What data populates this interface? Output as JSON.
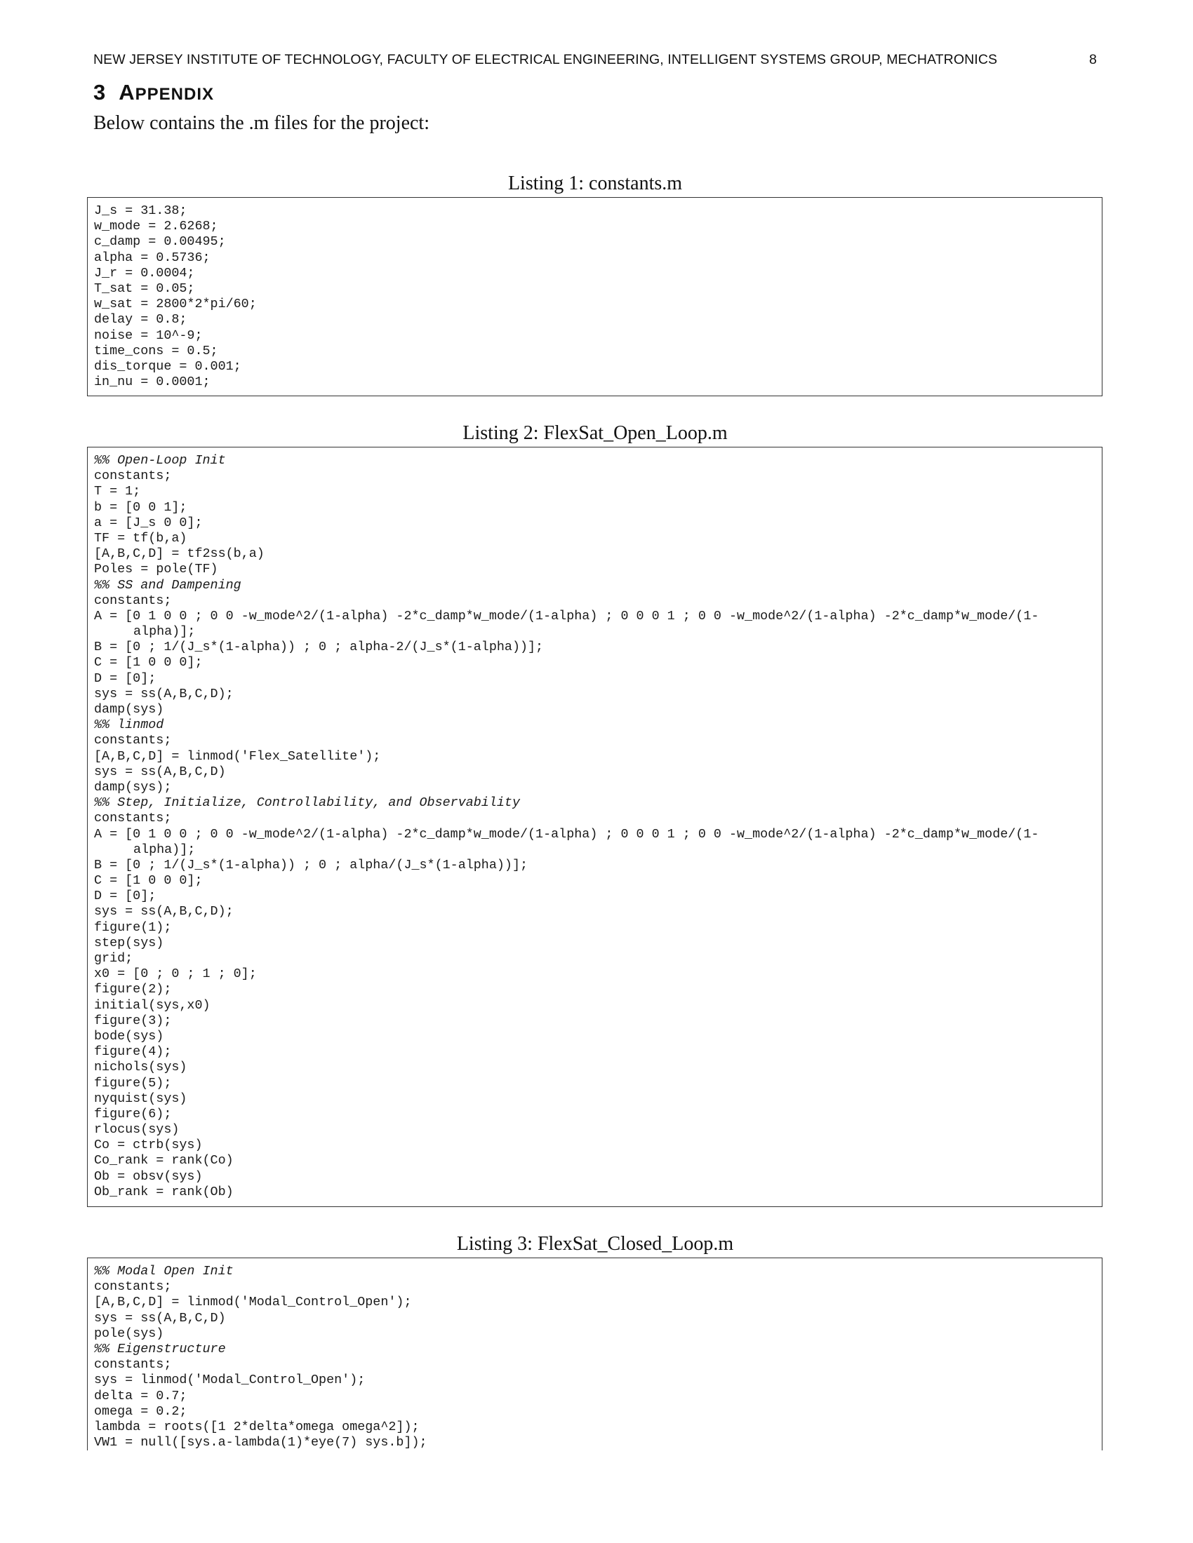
{
  "header": {
    "running_title": "NEW JERSEY INSTITUTE OF TECHNOLOGY, FACULTY OF ELECTRICAL ENGINEERING, INTELLIGENT SYSTEMS GROUP, MECHATRONICS",
    "page_number": "8"
  },
  "section": {
    "number": "3",
    "title_first": "A",
    "title_rest": "PPENDIX"
  },
  "intro": "Below contains the .m files for the project:",
  "listings": [
    {
      "caption": "Listing 1: constants.m",
      "lines": [
        "J_s = 31.38;",
        "w_mode = 2.6268;",
        "c_damp = 0.00495;",
        "alpha = 0.5736;",
        "J_r = 0.0004;",
        "T_sat = 0.05;",
        "w_sat = 2800*2*pi/60;",
        "delay = 0.8;",
        "noise = 10^-9;",
        "time_cons = 0.5;",
        "dis_torque = 0.001;",
        "in_nu = 0.0001;"
      ]
    },
    {
      "caption": "Listing 2: FlexSat_Open_Loop.m",
      "lines": [
        "%% Open-Loop Init",
        "constants;",
        "T = 1;",
        "b = [0 0 1];",
        "a = [J_s 0 0];",
        "TF = tf(b,a)",
        "[A,B,C,D] = tf2ss(b,a)",
        "Poles = pole(TF)",
        "%% SS and Dampening",
        "constants;",
        "A = [0 1 0 0 ; 0 0 -w_mode^2/(1-alpha) -2*c_damp*w_mode/(1-alpha) ; 0 0 0 1 ; 0 0 -w_mode^2/(1-alpha) -2*c_damp*w_mode/(1-",
        "alpha)];",
        "B = [0 ; 1/(J_s*(1-alpha)) ; 0 ; alpha-2/(J_s*(1-alpha))];",
        "C = [1 0 0 0];",
        "D = [0];",
        "sys = ss(A,B,C,D);",
        "damp(sys)",
        "%% linmod",
        "constants;",
        "[A,B,C,D] = linmod('Flex_Satellite');",
        "sys = ss(A,B,C,D)",
        "damp(sys);",
        "%% Step, Initialize, Controllability, and Observability",
        "constants;",
        "A = [0 1 0 0 ; 0 0 -w_mode^2/(1-alpha) -2*c_damp*w_mode/(1-alpha) ; 0 0 0 1 ; 0 0 -w_mode^2/(1-alpha) -2*c_damp*w_mode/(1-",
        "alpha)];",
        "B = [0 ; 1/(J_s*(1-alpha)) ; 0 ; alpha/(J_s*(1-alpha))];",
        "C = [1 0 0 0];",
        "D = [0];",
        "sys = ss(A,B,C,D);",
        "figure(1);",
        "step(sys)",
        "grid;",
        "x0 = [0 ; 0 ; 1 ; 0];",
        "figure(2);",
        "initial(sys,x0)",
        "figure(3);",
        "bode(sys)",
        "figure(4);",
        "nichols(sys)",
        "figure(5);",
        "nyquist(sys)",
        "figure(6);",
        "rlocus(sys)",
        "Co = ctrb(sys)",
        "Co_rank = rank(Co)",
        "Ob = obsv(sys)",
        "Ob_rank = rank(Ob)"
      ]
    },
    {
      "caption": "Listing 3: FlexSat_Closed_Loop.m",
      "lines": [
        "%% Modal Open Init",
        "constants;",
        "[A,B,C,D] = linmod('Modal_Control_Open');",
        "sys = ss(A,B,C,D)",
        "pole(sys)",
        "%% Eigenstructure",
        "constants;",
        "sys = linmod('Modal_Control_Open');",
        "delta = 0.7;",
        "omega = 0.2;",
        "lambda = roots([1 2*delta*omega omega^2]);",
        "VW1 = null([sys.a-lambda(1)*eye(7) sys.b]);"
      ]
    }
  ]
}
